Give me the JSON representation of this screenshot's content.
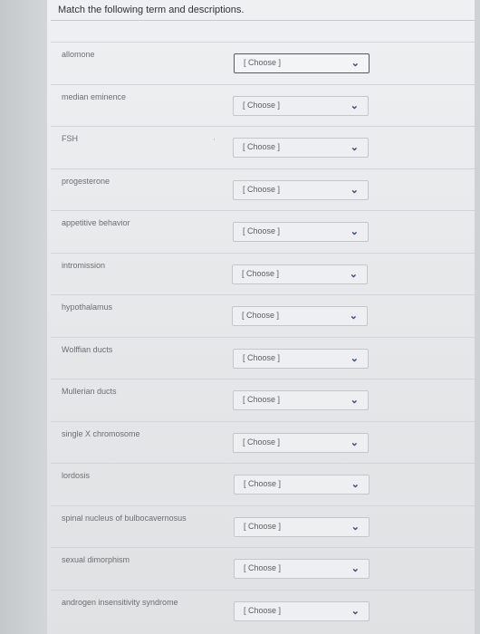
{
  "title": "Match the following term and descriptions.",
  "rows": [
    {
      "term": "allomone",
      "selected": "[ Choose ]",
      "chevron": "chevron-down-icon"
    },
    {
      "term": "median eminence",
      "selected": "[ Choose ]",
      "chevron": "chevron-down-icon"
    },
    {
      "term": "FSH",
      "selected": "[ Choose ]",
      "chevron": "chevron-down-icon"
    },
    {
      "term": "progesterone",
      "selected": "[ Choose ]",
      "chevron": "chevron-down-icon"
    },
    {
      "term": "appetitive behavior",
      "selected": "[ Choose ]",
      "chevron": "chevron-down-icon"
    },
    {
      "term": "intromission",
      "selected": "[ Choose ]",
      "chevron": "chevron-down-icon"
    },
    {
      "term": "hypothalamus",
      "selected": "[ Choose ]",
      "chevron": "chevron-down-icon"
    },
    {
      "term": "Wolffian ducts",
      "selected": "[ Choose ]",
      "chevron": "chevron-down-icon"
    },
    {
      "term": "Mullerian ducts",
      "selected": "[ Choose ]",
      "chevron": "chevron-down-icon"
    },
    {
      "term": "single X chromosome",
      "selected": "[ Choose ]",
      "chevron": "chevron-down-icon"
    },
    {
      "term": "lordosis",
      "selected": "[ Choose ]",
      "chevron": "chevron-down-icon"
    },
    {
      "term": "spinal nucleus of bulbocavernosus",
      "selected": "[ Choose ]",
      "chevron": "chevron-down-icon"
    },
    {
      "term": "sexual dimorphism",
      "selected": "[ Choose ]",
      "chevron": "chevron-down-icon"
    },
    {
      "term": "androgen insensitivity syndrome",
      "selected": "[ Choose ]",
      "chevron": "chevron-down-icon"
    }
  ],
  "chevron_glyph": "⌄",
  "accent_color": "#3c4a8a"
}
